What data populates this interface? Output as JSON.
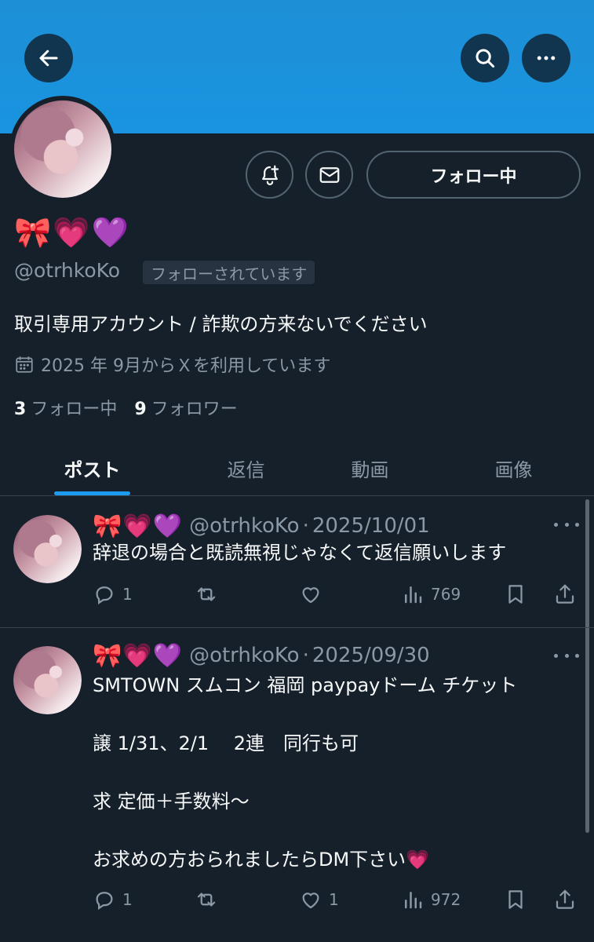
{
  "header": {
    "back_icon": "arrow-left-icon",
    "search_icon": "search-icon",
    "more_icon": "more-horizontal-icon"
  },
  "profile": {
    "display_name": "🎀💗💜",
    "handle": "@otrhkoKo",
    "follows_you": "フォローされています",
    "bio": "取引専用アカウント / 詐欺の方来ないでください",
    "joined": "2025 年 9月からＸを利用しています",
    "following_count": "3",
    "following_label": "フォロー中",
    "followers_count": "9",
    "followers_label": "フォロワー",
    "follow_button": "フォロー中"
  },
  "tabs": [
    {
      "label": "ポスト",
      "active": true
    },
    {
      "label": "返信",
      "active": false
    },
    {
      "label": "動画",
      "active": false
    },
    {
      "label": "画像",
      "active": false
    }
  ],
  "posts": [
    {
      "name": "🎀💗💜",
      "handle": "@otrhkoKo",
      "date": "2025/10/01",
      "text": "辞退の場合と既読無視じゃなくて返信願いします",
      "replies": "1",
      "retweets": "",
      "likes": "",
      "views": "769"
    },
    {
      "name": "🎀💗💜",
      "handle": "@otrhkoKo",
      "date": "2025/09/30",
      "text": "SMTOWN スムコン 福岡 paypayドーム チケット\n\n譲 1/31、2/1　 2連　同行も可\n\n求 定価＋手数料〜\n\nお求めの方おられましたらDM下さい💗",
      "replies": "1",
      "retweets": "",
      "likes": "1",
      "views": "972"
    }
  ],
  "colors": {
    "background": "#15202b",
    "banner": "#1d8fd6",
    "accent": "#1d9bf0",
    "muted": "#8b98a5"
  }
}
